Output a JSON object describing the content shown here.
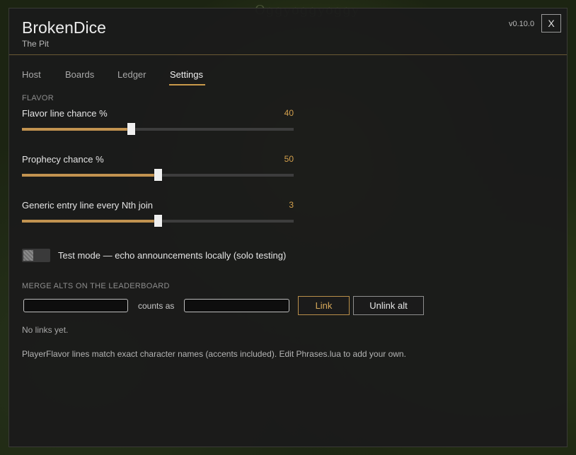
{
  "background": {
    "overhead_text": "Oggyoggyoggy"
  },
  "header": {
    "title": "BrokenDice",
    "subtitle": "The Pit",
    "version": "v0.10.0",
    "close_label": "X"
  },
  "tabs": [
    {
      "label": "Host",
      "active": false
    },
    {
      "label": "Boards",
      "active": false
    },
    {
      "label": "Ledger",
      "active": false
    },
    {
      "label": "Settings",
      "active": true
    }
  ],
  "flavor": {
    "section_label": "FLAVOR",
    "sliders": [
      {
        "label": "Flavor line chance %",
        "value": "40",
        "fill_fraction": 0.4
      },
      {
        "label": "Prophecy chance %",
        "value": "50",
        "fill_fraction": 0.5
      },
      {
        "label": "Generic entry line every Nth join",
        "value": "3",
        "fill_fraction": 0.5
      }
    ],
    "test_mode": {
      "label": "Test mode — echo announcements locally (solo testing)",
      "enabled": false
    }
  },
  "merge": {
    "section_label": "MERGE ALTS ON THE LEADERBOARD",
    "alt_input_value": "",
    "counts_as_label": "counts as",
    "main_input_value": "",
    "link_label": "Link",
    "unlink_label": "Unlink alt",
    "empty_text": "No links yet."
  },
  "footnote": "PlayerFlavor lines match exact character names (accents included). Edit Phrases.lua to add your own.",
  "colors": {
    "accent": "#c9994a",
    "value_text": "#d3a04d",
    "panel_bg": "#1b1b1b"
  }
}
